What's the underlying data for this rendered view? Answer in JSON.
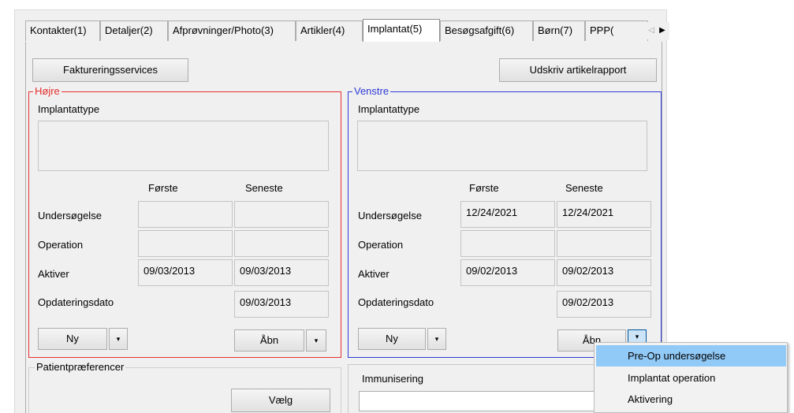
{
  "tabs": [
    {
      "label": "Kontakter(1)",
      "active": false
    },
    {
      "label": "Detaljer(2)",
      "active": false
    },
    {
      "label": "Afprøvninger/Photo(3)",
      "active": false
    },
    {
      "label": "Artikler(4)",
      "active": false
    },
    {
      "label": "Implantat(5)",
      "active": true
    },
    {
      "label": "Besøgsafgift(6)",
      "active": false
    },
    {
      "label": "Børn(7)",
      "active": false
    },
    {
      "label": "PPP(",
      "active": false
    }
  ],
  "toolbar": {
    "billing_label": "Faktureringsservices",
    "print_report_label": "Udskriv artikelrapport"
  },
  "right_side": {
    "legend": "Højre",
    "color": "#e62e2e",
    "implant_type_label": "Implantattype",
    "implant_type_value": "",
    "col_first": "Første",
    "col_latest": "Seneste",
    "rows": [
      {
        "label": "Undersøgelse",
        "first": "",
        "latest": ""
      },
      {
        "label": "Operation",
        "first": "",
        "latest": ""
      },
      {
        "label": "Aktiver",
        "first": "09/03/2013",
        "latest": "09/03/2013"
      },
      {
        "label": "Opdateringsdato",
        "latest": "09/03/2013"
      }
    ],
    "new_label": "Ny",
    "open_label": "Åbn"
  },
  "left_side": {
    "legend": "Venstre",
    "color": "#2e3ad6",
    "implant_type_label": "Implantattype",
    "implant_type_value": "",
    "col_first": "Første",
    "col_latest": "Seneste",
    "rows": [
      {
        "label": "Undersøgelse",
        "first": "12/24/2021",
        "latest": "12/24/2021"
      },
      {
        "label": "Operation",
        "first": "",
        "latest": ""
      },
      {
        "label": "Aktiver",
        "first": "09/02/2013",
        "latest": "09/02/2013"
      },
      {
        "label": "Opdateringsdato",
        "latest": "09/02/2013"
      }
    ],
    "new_label": "Ny",
    "open_label": "Åbn"
  },
  "preferences": {
    "legend": "Patientpræferencer",
    "choose_label": "Vælg"
  },
  "immunization": {
    "label": "Immunisering"
  },
  "dropdown_menu": {
    "items": [
      {
        "label": "Pre-Op undersøgelse",
        "highlighted": true
      },
      {
        "label": "Implantat operation",
        "highlighted": false
      },
      {
        "label": "Aktivering",
        "highlighted": false
      }
    ]
  },
  "icons": {
    "dropdown_arrow": "▾",
    "tab_scroll_left": "◁",
    "tab_scroll_right": "▶"
  }
}
